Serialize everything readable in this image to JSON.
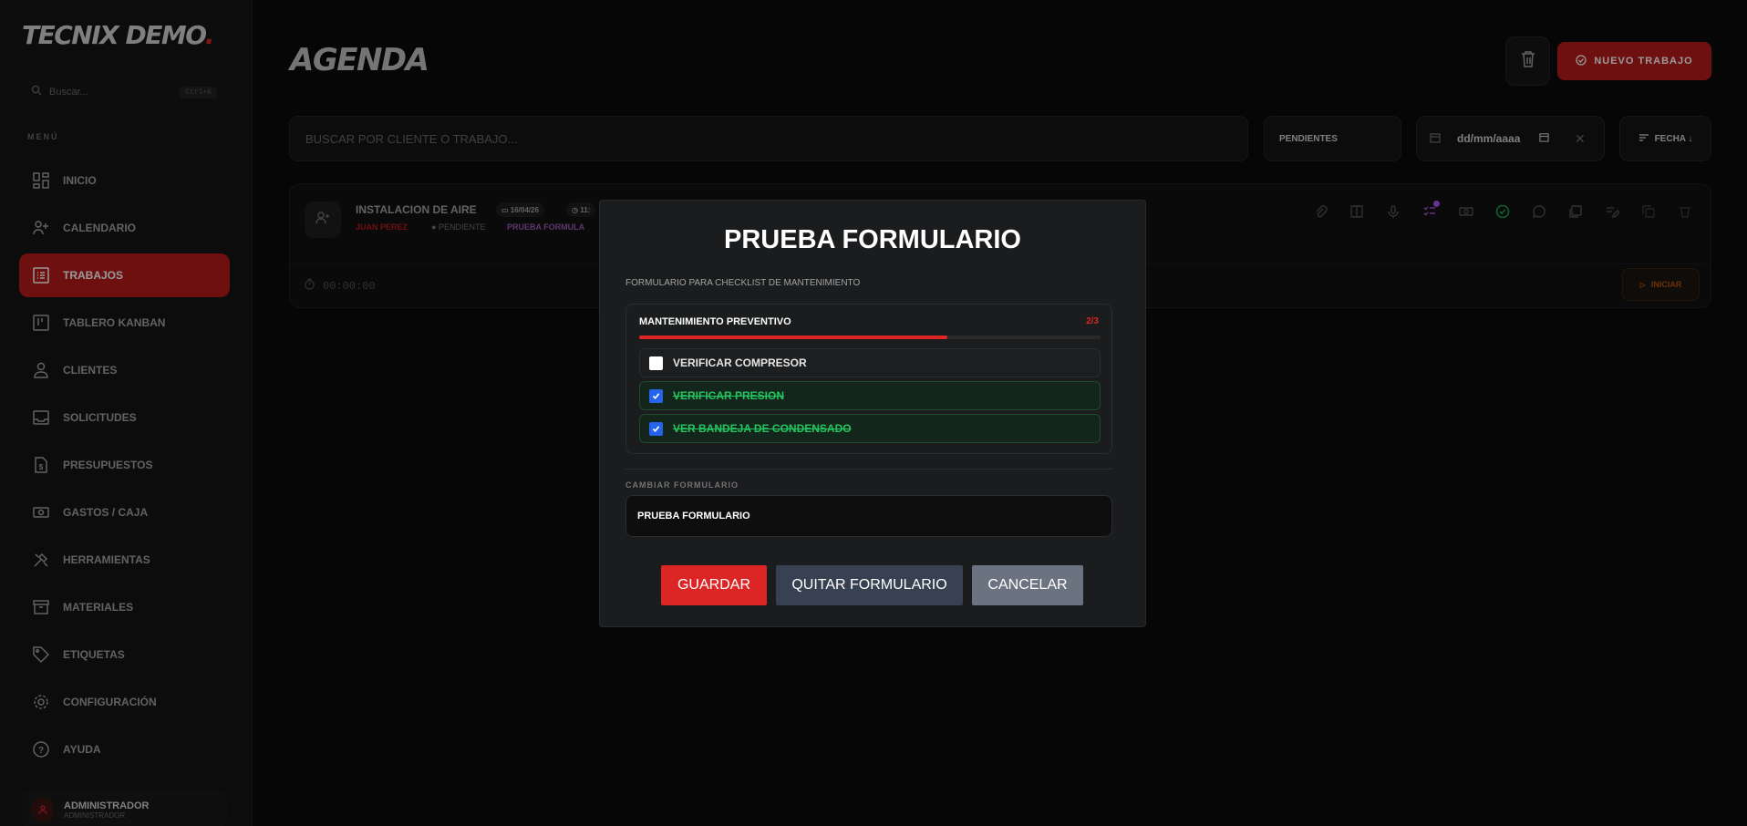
{
  "sidebar": {
    "logo_text": "TECNIX DEMO",
    "logo_dot": ".",
    "search_placeholder": "Buscar...",
    "search_shortcut": "Ctrl+K",
    "menu_label": "MENÚ",
    "items": [
      {
        "label": "INICIO",
        "icon": "dashboard-icon"
      },
      {
        "label": "CALENDARIO",
        "icon": "users-calendar-icon"
      },
      {
        "label": "TRABAJOS",
        "icon": "list-icon",
        "active": true
      },
      {
        "label": "TABLERO KANBAN",
        "icon": "kanban-icon"
      },
      {
        "label": "CLIENTES",
        "icon": "user-icon"
      },
      {
        "label": "SOLICITUDES",
        "icon": "inbox-icon"
      },
      {
        "label": "PRESUPUESTOS",
        "icon": "file-dollar-icon"
      },
      {
        "label": "GASTOS / CAJA",
        "icon": "cash-icon"
      },
      {
        "label": "HERRAMIENTAS",
        "icon": "tools-icon"
      },
      {
        "label": "MATERIALES",
        "icon": "archive-icon"
      },
      {
        "label": "ETIQUETAS",
        "icon": "tag-icon"
      },
      {
        "label": "CONFIGURACIÓN",
        "icon": "gear-icon"
      },
      {
        "label": "AYUDA",
        "icon": "help-icon"
      }
    ],
    "user": {
      "name": "ADMINISTRADOR",
      "role": "ADMINISTRADOR"
    }
  },
  "header": {
    "title": "AGENDA",
    "new_button": "NUEVO TRABAJO"
  },
  "filters": {
    "search_placeholder": "BUSCAR POR CLIENTE O TRABAJO...",
    "status": "PENDIENTES",
    "date_placeholder": "dd/mm/aaaa",
    "date_clear": "✕",
    "sort": "FECHA ↓"
  },
  "job": {
    "title": "INSTALACION DE AIRE",
    "date": "16/04/26",
    "time": "11:",
    "client": "JUAN PEREZ",
    "status": "● PENDIENTE",
    "form": "PRUEBA FORMULA",
    "timer": "00:00:00",
    "start_button": "INICIAR"
  },
  "modal": {
    "title": "PRUEBA FORMULARIO",
    "description": "FORMULARIO PARA CHECKLIST DE MANTENIMIENTO",
    "section_title": "MANTENIMIENTO PREVENTIVO",
    "progress_text": "2/3",
    "progress": 0.667,
    "items": [
      {
        "label": "VERIFICAR COMPRESOR",
        "checked": false
      },
      {
        "label": "VERIFICAR PRESION",
        "checked": true
      },
      {
        "label": "VER BANDEJA DE CONDENSADO",
        "checked": true
      }
    ],
    "change_label": "CAMBIAR FORMULARIO",
    "selected_form": "PRUEBA FORMULARIO",
    "save": "GUARDAR",
    "remove": "QUITAR FORMULARIO",
    "cancel": "CANCELAR"
  },
  "colors": {
    "accent": "#b91c1c",
    "accent_bright": "#dc2626",
    "done": "#22c55e",
    "checkbox": "#2563eb"
  }
}
